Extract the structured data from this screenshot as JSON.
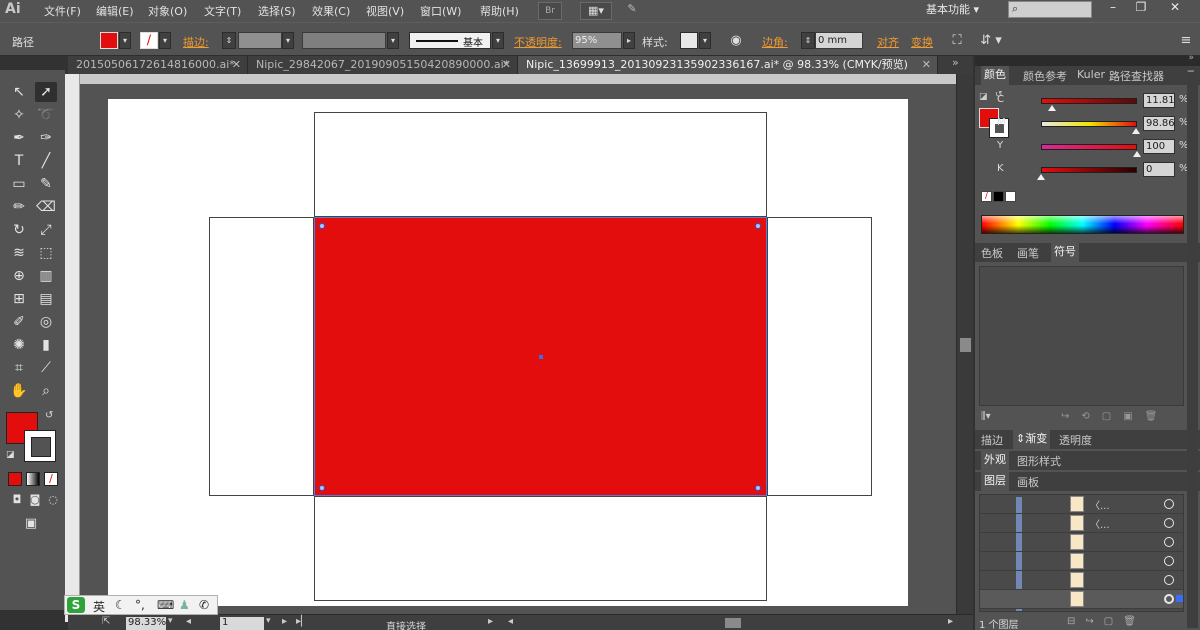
{
  "app": {
    "logo": "Ai"
  },
  "menubar": {
    "items": [
      "文件(F)",
      "编辑(E)",
      "对象(O)",
      "文字(T)",
      "选择(S)",
      "效果(C)",
      "视图(V)",
      "窗口(W)",
      "帮助(H)"
    ],
    "bridge_label": "Br",
    "workspace": "基本功能",
    "window_controls": [
      "–",
      "❐",
      "✕"
    ]
  },
  "controlbar": {
    "selection_label": "路径",
    "stroke_label": "描边:",
    "stroke_style": "基本",
    "opacity_label": "不透明度:",
    "opacity_value": "95%",
    "style_label": "样式:",
    "corner_label": "边角:",
    "corner_value": "0 mm",
    "align_label": "对齐",
    "transform_label": "变换"
  },
  "tabs": [
    {
      "label": "20150506172614816000.ai*",
      "active": false
    },
    {
      "label": "Nipic_29842067_20190905150420890000.ai*",
      "active": false
    },
    {
      "label": "Nipic_13699913_20130923135902336167.ai* @ 98.33% (CMYK/预览)",
      "active": true
    }
  ],
  "colors": {
    "fill": "#e30d0d",
    "selection": "#3b6cf6",
    "accent_orange": "#f09a2f"
  },
  "color_panel": {
    "tabs": [
      "颜色",
      "颜色参考",
      "Kuler",
      "路径查找器"
    ],
    "sliders": [
      {
        "name": "C",
        "value": "11.81",
        "percent": 11.81,
        "gradient": "linear-gradient(90deg,#e30d0d,#5a0a0a)"
      },
      {
        "name": "M",
        "value": "98.86",
        "percent": 98.86,
        "gradient": "linear-gradient(90deg,#e8e8e8,#f0e600,#e30d0d)"
      },
      {
        "name": "Y",
        "value": "100",
        "percent": 100,
        "gradient": "linear-gradient(90deg,#d8299a,#e30d0d)"
      },
      {
        "name": "K",
        "value": "0",
        "percent": 0,
        "gradient": "linear-gradient(90deg,#e30d0d,#2a0000)"
      }
    ],
    "percent_sign": "%"
  },
  "swatch_panel": {
    "tabs": [
      "色板",
      "画笔",
      "符号"
    ]
  },
  "stroke_panel": {
    "tabs": [
      "描边",
      "渐变",
      "透明度"
    ]
  },
  "appearance_panel": {
    "tabs": [
      "外观",
      "图形样式"
    ]
  },
  "layers_panel": {
    "tabs": [
      "图层",
      "画板"
    ],
    "rows": [
      "〈...",
      "〈..."
    ],
    "footer": "1 个图层"
  },
  "statusbar": {
    "zoom": "98.33%",
    "page": "1",
    "tool": "直接选择"
  },
  "ime": {
    "logo": "S",
    "mode": "英"
  }
}
